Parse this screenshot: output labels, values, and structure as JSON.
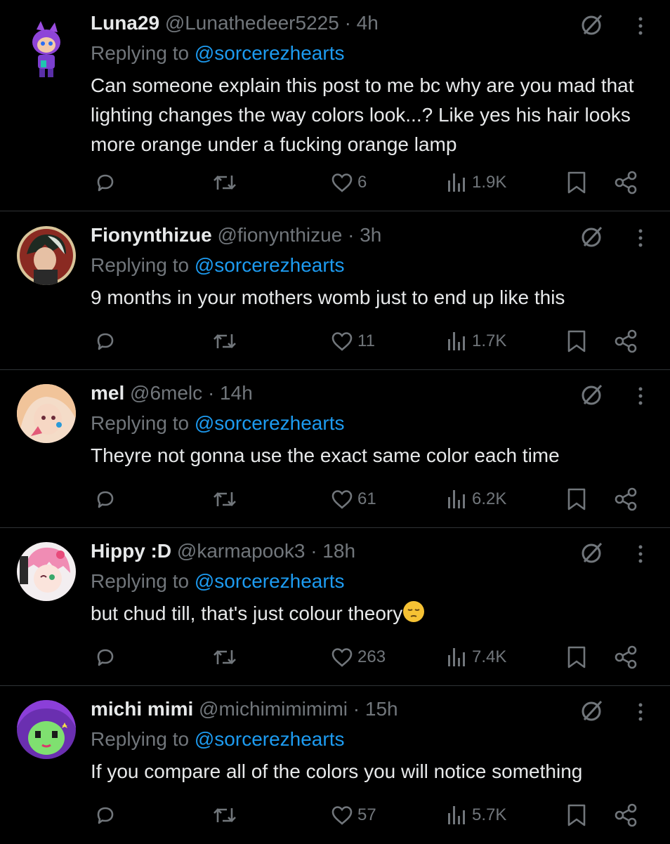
{
  "tweets": [
    {
      "name": "Luna29",
      "handle": "@Lunathedeer5225",
      "time": "4h",
      "replying_label": "Replying to",
      "replying_to": "@sorcerezhearts",
      "text": "Can someone explain this post to me bc why are you mad that lighting changes the way colors look...? Like yes his hair looks more orange under a fucking orange lamp",
      "likes": "6",
      "views": "1.9K",
      "avatar_icon": "avatar-purple-deer"
    },
    {
      "name": "Fionynthizue",
      "handle": "@fionynthizue",
      "time": "3h",
      "replying_label": "Replying to",
      "replying_to": "@sorcerezhearts",
      "text": "9 months in your mothers womb just to end up like this",
      "likes": "11",
      "views": "1.7K",
      "avatar_icon": "avatar-anime-dark-hair"
    },
    {
      "name": "mel",
      "handle": "@6melc",
      "time": "14h",
      "replying_label": "Replying to",
      "replying_to": "@sorcerezhearts",
      "text": "Theyre not gonna use the exact same color each time",
      "likes": "61",
      "views": "6.2K",
      "avatar_icon": "avatar-anime-blonde"
    },
    {
      "name": "Hippy :D",
      "handle": "@karmapook3",
      "time": "18h",
      "replying_label": "Replying to",
      "replying_to": "@sorcerezhearts",
      "text": "but chud till, that's just colour theory",
      "likes": "263",
      "views": "7.4K",
      "avatar_icon": "avatar-anime-pink-hair",
      "emoji": "pensive-face"
    },
    {
      "name": "michi mimi",
      "handle": "@michimimimimi",
      "time": "15h",
      "replying_label": "Replying to",
      "replying_to": "@sorcerezhearts",
      "text": "If you compare all of the colors you will notice something",
      "likes": "57",
      "views": "5.7K",
      "avatar_icon": "avatar-purple-hair-green-face"
    }
  ],
  "separator": "·",
  "colors": {
    "background": "#000000",
    "text": "#e7e9ea",
    "muted": "#71767b",
    "link": "#1d9bf0",
    "divider": "#2f3336"
  },
  "icons": [
    "reply-icon",
    "retweet-icon",
    "heart-icon",
    "views-icon",
    "bookmark-icon",
    "share-icon",
    "grok-icon",
    "more-icon"
  ]
}
